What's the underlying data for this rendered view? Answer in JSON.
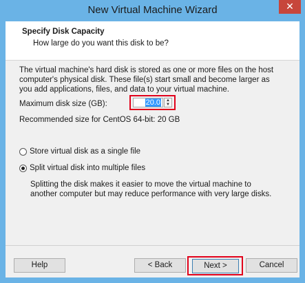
{
  "window": {
    "title": "New Virtual Machine Wizard",
    "close_glyph": "✕"
  },
  "header": {
    "title": "Specify Disk Capacity",
    "subtitle": "How large do you want this disk to be?"
  },
  "description": "The virtual machine's hard disk is stored as one or more files on the host computer's physical disk. These file(s) start small and become larger as you add applications, files, and data to your virtual machine.",
  "disk_size": {
    "label": "Maximum disk size (GB):",
    "value": "20.0"
  },
  "recommended": "Recommended size for CentOS 64-bit: 20 GB",
  "options": [
    {
      "label": "Store virtual disk as a single file",
      "checked": false
    },
    {
      "label": "Split virtual disk into multiple files",
      "checked": true
    }
  ],
  "split_description": "Splitting the disk makes it easier to move the virtual machine to another computer but may reduce performance with very large disks.",
  "buttons": {
    "help": "Help",
    "back": "< Back",
    "next": "Next >",
    "cancel": "Cancel"
  },
  "colors": {
    "titlebar": "#6ab3e6",
    "highlight_border": "#e0001a",
    "selection": "#3399ff"
  }
}
